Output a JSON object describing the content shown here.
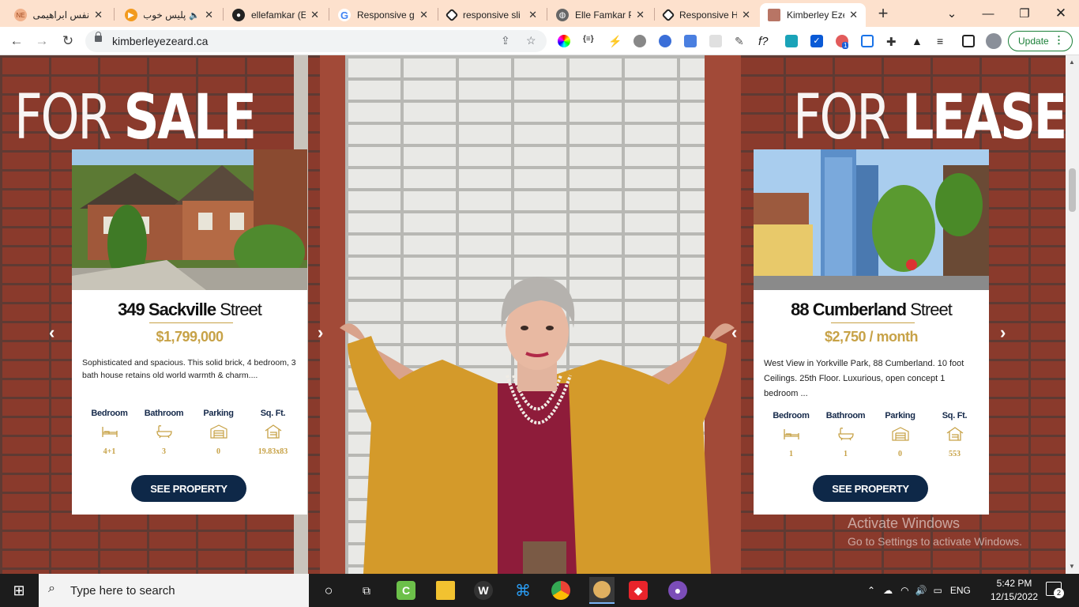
{
  "browser": {
    "tabs": [
      {
        "title": "نفس ابراهيمی",
        "favicon": "ne-icon",
        "color": "#e8a070",
        "active": false
      },
      {
        "title": "پلیس خوب",
        "favicon": "play-icon",
        "color": "#f29a1e",
        "active": false
      },
      {
        "title": "ellefamkar (El",
        "favicon": "github-icon",
        "color": "#222222",
        "active": false
      },
      {
        "title": "Responsive gi",
        "favicon": "google-icon",
        "color": "#4285f4",
        "active": false
      },
      {
        "title": "responsive sli",
        "favicon": "codepen-icon",
        "color": "#222222",
        "active": false
      },
      {
        "title": "Elle Famkar P",
        "favicon": "globe-icon",
        "color": "#555555",
        "active": false
      },
      {
        "title": "Responsive H",
        "favicon": "codepen-icon",
        "color": "#222222",
        "active": false
      },
      {
        "title": "Kimberley Eze",
        "favicon": "site-icon",
        "color": "#aa6655",
        "active": true
      }
    ],
    "url": "kimberleyezeard.ca",
    "update_label": "Update",
    "extension_badge": "1"
  },
  "page": {
    "sale_heading_light": "FOR",
    "sale_heading_bold": "SALE",
    "lease_heading_light": "FOR",
    "lease_heading_bold": "LEASE",
    "listings": [
      {
        "number": "349",
        "street_bold": "Sackville",
        "street_suffix": "Street",
        "price": "$1,799,000",
        "description": "Sophisticated and spacious. This solid brick, 4 bedroom, 3 bath house retains old world warmth & charm....",
        "specs": [
          {
            "label": "Bedroom",
            "value": "4+1",
            "icon": "bed-icon"
          },
          {
            "label": "Bathroom",
            "value": "3",
            "icon": "bathtub-icon"
          },
          {
            "label": "Parking",
            "value": "0",
            "icon": "garage-icon"
          },
          {
            "label": "Sq. Ft.",
            "value": "19.83x83",
            "icon": "house-icon"
          }
        ],
        "button": "SEE PROPERTY"
      },
      {
        "number": "88",
        "street_bold": "Cumberland",
        "street_suffix": "Street",
        "price": "$2,750 / month",
        "description": "West View in Yorkville Park, 88 Cumberland. 10 foot Ceilings. 25th Floor. Luxurious, open concept 1 bedroom ...",
        "specs": [
          {
            "label": "Bedroom",
            "value": "1",
            "icon": "bed-icon"
          },
          {
            "label": "Bathroom",
            "value": "1",
            "icon": "bathtub-icon"
          },
          {
            "label": "Parking",
            "value": "0",
            "icon": "garage-icon"
          },
          {
            "label": "Sq. Ft.",
            "value": "553",
            "icon": "house-icon"
          }
        ],
        "button": "SEE PROPERTY"
      }
    ],
    "watermark_title": "Activate Windows",
    "watermark_sub": "Go to Settings to activate Windows."
  },
  "taskbar": {
    "search_placeholder": "Type here to search",
    "language": "ENG",
    "time": "5:42 PM",
    "date": "12/15/2022",
    "notification_count": "2"
  },
  "colors": {
    "gold": "#c7a247",
    "navy": "#0e2848",
    "tab_bar": "#fde1cd"
  }
}
